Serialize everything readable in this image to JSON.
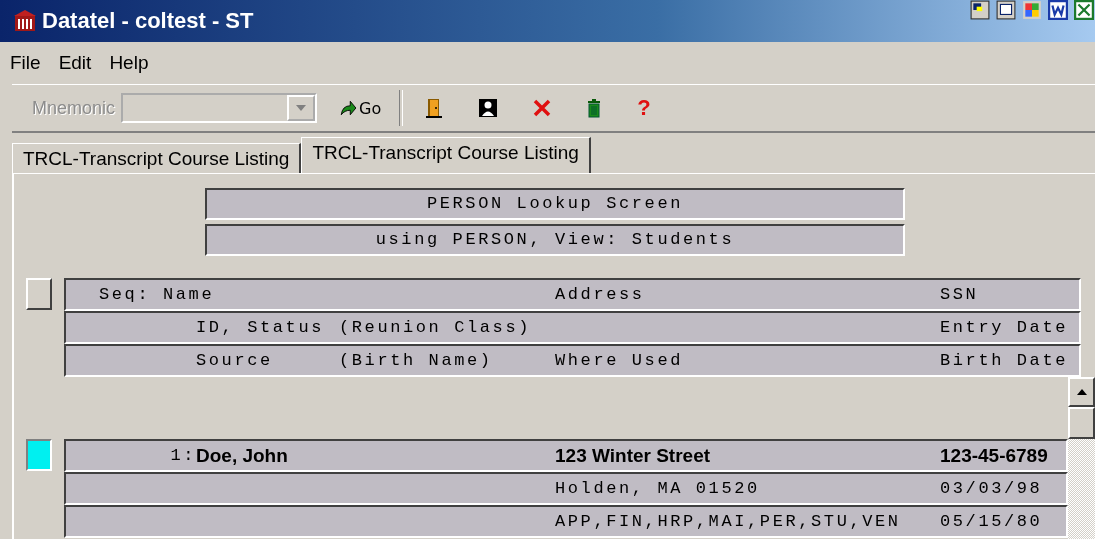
{
  "window": {
    "title": "Datatel - coltest - ST"
  },
  "menu": [
    "File",
    "Edit",
    "Help"
  ],
  "toolbar": {
    "mnemonic_label": "Mnemonic",
    "mnemonic_disabled": true,
    "go_label": "Go",
    "help_label": "?"
  },
  "tabs": [
    {
      "label": "TRCL-Transcript Course Listing",
      "selected": false
    },
    {
      "label": "TRCL-Transcript Course Listing",
      "selected": true
    }
  ],
  "screen_titles": [
    "PERSON Lookup Screen",
    "using PERSON, View: Students"
  ],
  "header": {
    "selected": false,
    "lines": [
      {
        "bold": false,
        "cells": {
          "label": "Seq: Name",
          "address": "Address",
          "info": "SSN"
        }
      },
      {
        "bold": false,
        "cells": {
          "name": "ID, Status",
          "detail": "(Reunion Class)",
          "info": "Entry Date"
        }
      },
      {
        "bold": false,
        "cells": {
          "name": "Source",
          "detail": "(Birth Name)",
          "address": "Where Used",
          "info": "Birth Date"
        }
      }
    ]
  },
  "records": [
    {
      "selected": true,
      "lines": [
        {
          "bold": true,
          "cells": {
            "number": "1:",
            "name": "Doe, John",
            "address": "123 Winter Street",
            "info": "123-45-6789"
          }
        },
        {
          "bold": false,
          "cells": {
            "address": "Holden, MA 01520",
            "info": "03/03/98"
          }
        },
        {
          "bold": false,
          "cells": {
            "address": "APP,FIN,HRP,MAI,PER,STU,VEN",
            "info": "05/15/80"
          }
        }
      ]
    }
  ]
}
